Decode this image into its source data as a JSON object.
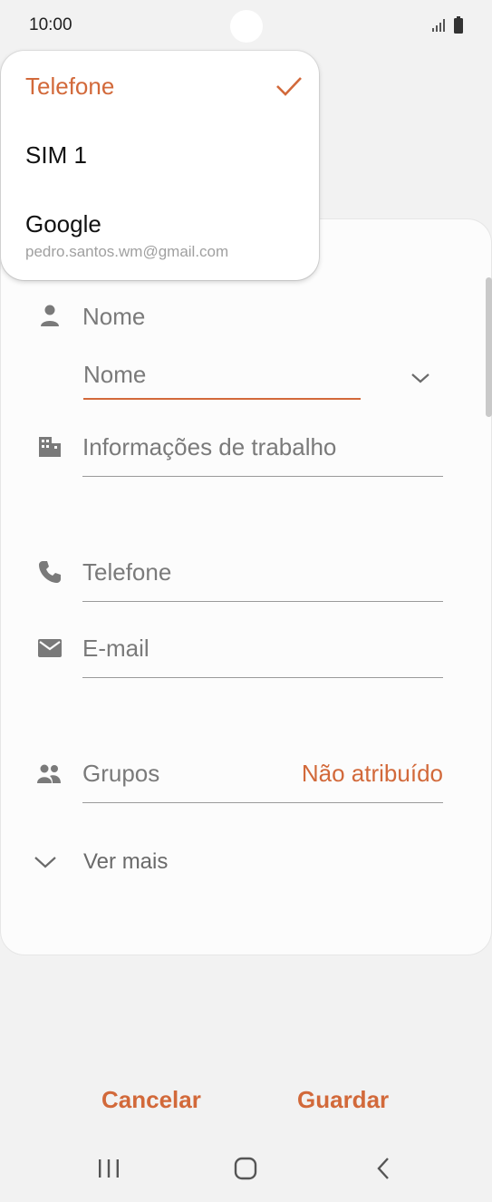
{
  "status": {
    "time": "10:00"
  },
  "dropdown": {
    "items": [
      {
        "label": "Telefone",
        "selected": true
      },
      {
        "label": "SIM 1"
      },
      {
        "label": "Google",
        "sub": "pedro.santos.wm@gmail.com"
      }
    ]
  },
  "form": {
    "name_label": "Nome",
    "name_field_placeholder": "Nome",
    "work_info": "Informações de trabalho",
    "phone": "Telefone",
    "email": "E-mail",
    "groups_label": "Grupos",
    "groups_value": "Não atribuído",
    "see_more": "Ver mais"
  },
  "actions": {
    "cancel": "Cancelar",
    "save": "Guardar"
  },
  "icons": {
    "person": "person-icon",
    "work": "building-icon",
    "phone": "phone-icon",
    "email": "envelope-icon",
    "groups": "people-icon",
    "expand": "chevron-down-icon",
    "check": "check-icon"
  },
  "colors": {
    "accent": "#d2693a",
    "background": "#f2f2f2",
    "card": "#fcfcfc"
  }
}
